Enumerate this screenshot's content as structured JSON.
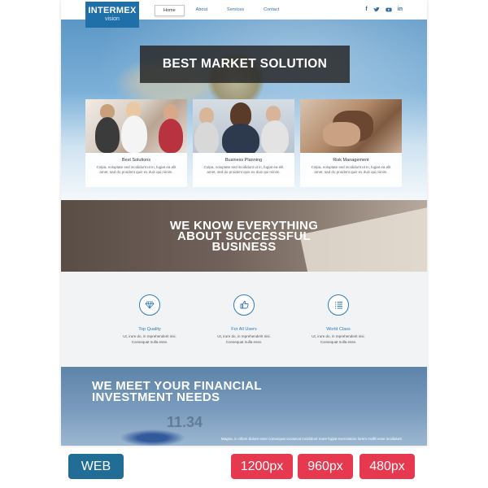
{
  "logo": {
    "line1": "INTERMEX",
    "line2": "vision"
  },
  "nav": {
    "items": [
      {
        "label": "Home",
        "active": true
      },
      {
        "label": "About"
      },
      {
        "label": "Services"
      },
      {
        "label": "Contact"
      }
    ]
  },
  "social": [
    "f",
    "t",
    "yt",
    "in"
  ],
  "hero": {
    "title": "BEST MARKET SOLUTION",
    "cards": [
      {
        "title": "Best Solutions",
        "text": "Culpa, voluptate sed incididunt ut in, fugiat ea elit amet, sed do proident quis ex duis qui minim."
      },
      {
        "title": "Business Planning",
        "text": "Culpa, voluptate sed incididunt ut in, fugiat ea elit amet, sed do proident quis ex duis qui minim."
      },
      {
        "title": "Risk Management",
        "text": "Culpa, voluptate sed incididunt ut in, fugiat ea elit amet, sed do proident quis ex duis qui minim."
      }
    ]
  },
  "know": {
    "line1": "WE KNOW EVERYTHING",
    "line2": "ABOUT SUCCESSFUL",
    "line3": "BUSINESS"
  },
  "features": [
    {
      "icon": "diamond-icon",
      "title": "Top Quality",
      "line1": "Ut, irure do, in reprehenderit nisi.",
      "line2": "Consequat nulla esse."
    },
    {
      "icon": "thumbs-up-icon",
      "title": "For All Users",
      "line1": "Ut, irure do, in reprehenderit nisi.",
      "line2": "Consequat nulla esse."
    },
    {
      "icon": "list-icon",
      "title": "World Class",
      "line1": "Ut, irure do, in reprehenderit nisi.",
      "line2": "Consequat nulla esse."
    }
  ],
  "invest": {
    "line1": "WE MEET YOUR FINANCIAL",
    "line2": "INVESTMENT NEEDS",
    "text": "Magna, in cillum dolore esse consequat occaecat incididunt mare fugiat exercitation lorem mollit esse incididunt."
  },
  "badges": [
    "WEB",
    "1200px",
    "960px",
    "480px"
  ],
  "colors": {
    "brand": "#1f6fa8",
    "accent_red": "#e6394f",
    "web_badge": "#216d96"
  }
}
